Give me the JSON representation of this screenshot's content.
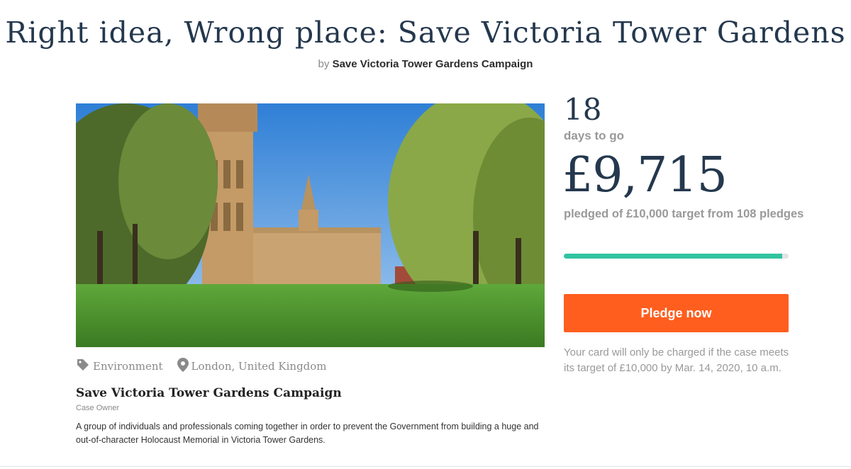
{
  "title": "Right idea, Wrong place: Save Victoria Tower Gardens",
  "byline": {
    "prefix": "by",
    "owner": "Save Victoria Tower Gardens Campaign"
  },
  "hero": {
    "icon": "photo-of-victoria-tower-gardens"
  },
  "tags": {
    "category": {
      "icon": "tag-icon",
      "label": "Environment"
    },
    "location": {
      "icon": "map-pin-icon",
      "label": "London, United Kingdom"
    }
  },
  "owner": {
    "name": "Save Victoria Tower Gardens Campaign",
    "role": "Case Owner",
    "description": "A group of individuals and professionals coming together in order to prevent the Government from building a huge and out-of-character Holocaust Memorial in Victoria Tower Gardens."
  },
  "stats": {
    "days": "18",
    "days_label": "days to go",
    "amount": "£9,715",
    "pledged_label": "pledged of £10,000 target from 108 pledges",
    "progress_fraction": 0.9715
  },
  "cta": {
    "pledge_label": "Pledge now"
  },
  "charge_note": "Your card will only be charged if the case meets its target of £10,000 by Mar. 14, 2020, 10 a.m.",
  "colors": {
    "title": "#24384e",
    "progress": "#31c4a1",
    "button": "#ff5e1f",
    "muted": "#999999"
  }
}
